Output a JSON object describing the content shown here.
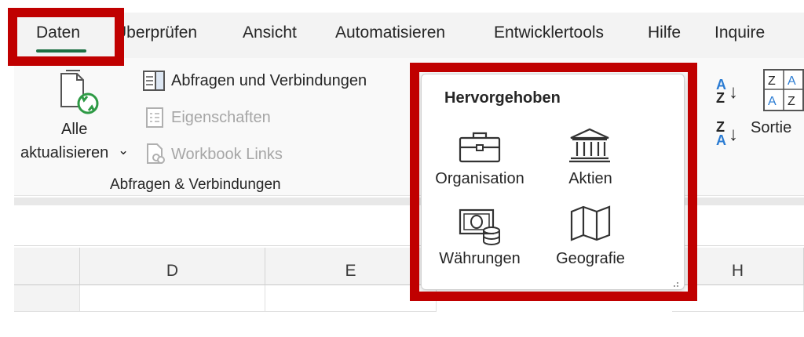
{
  "colors": {
    "highlight": "#c00000",
    "accent_green": "#1e7145",
    "sort_blue": "#2b7cd3"
  },
  "tabs": [
    "Daten",
    "Überprüfen",
    "Ansicht",
    "Automatisieren",
    "Entwicklertools",
    "Hilfe",
    "Inquire"
  ],
  "ribbon": {
    "refresh": {
      "line1": "Alle",
      "line2": "aktualisieren",
      "caret": "⌄"
    },
    "queries": [
      {
        "label": "Abfragen und Verbindungen",
        "enabled": true
      },
      {
        "label": "Eigenschaften",
        "enabled": false
      },
      {
        "label": "Workbook Links",
        "enabled": false
      }
    ],
    "group_label": "Abfragen & Verbindungen",
    "sort": {
      "az_top": "A",
      "az_bottom": "Z",
      "za_top": "Z",
      "za_bottom": "A",
      "arrow": "↓",
      "label": "Sortie"
    }
  },
  "datatypes": {
    "title": "Hervorgehoben",
    "items": [
      {
        "label": "Organisation",
        "icon": "briefcase-icon"
      },
      {
        "label": "Aktien",
        "icon": "bank-icon"
      },
      {
        "label": "Währungen",
        "icon": "currency-icon"
      },
      {
        "label": "Geografie",
        "icon": "map-icon"
      }
    ]
  },
  "grid": {
    "columns": [
      "D",
      "E",
      "",
      "",
      "H"
    ]
  }
}
